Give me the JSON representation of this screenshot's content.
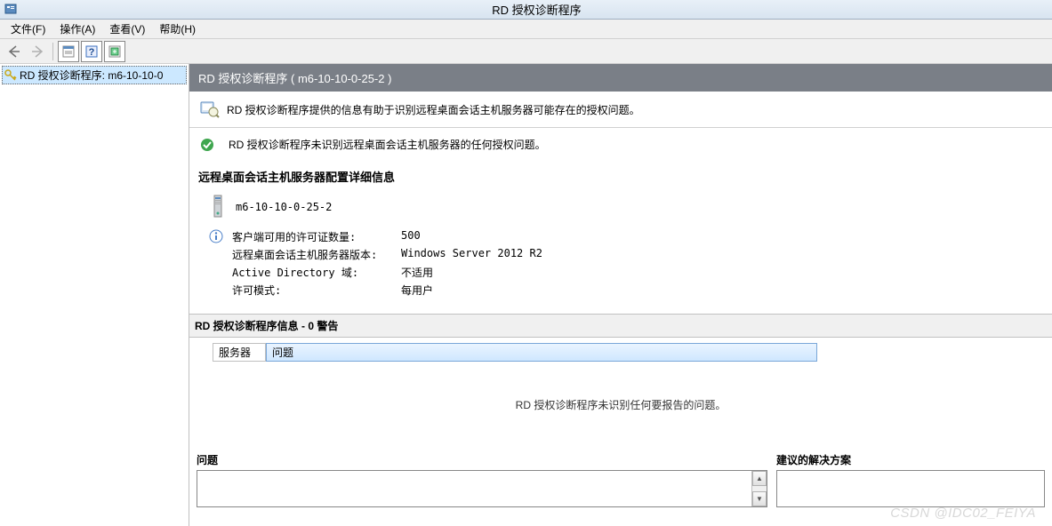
{
  "window": {
    "title": "RD 授权诊断程序"
  },
  "menu": {
    "file": "文件(F)",
    "action": "操作(A)",
    "view": "查看(V)",
    "help": "帮助(H)"
  },
  "tree": {
    "root": "RD 授权诊断程序: m6-10-10-0"
  },
  "header": {
    "title": "RD 授权诊断程序 ( m6-10-10-0-25-2 )"
  },
  "strip": {
    "text": "RD 授权诊断程序提供的信息有助于识别远程桌面会话主机服务器可能存在的授权问题。"
  },
  "ok": {
    "text": "RD 授权诊断程序未识别远程桌面会话主机服务器的任何授权问题。"
  },
  "section": {
    "title": "远程桌面会话主机服务器配置详细信息"
  },
  "server": {
    "name": "m6-10-10-0-25-2"
  },
  "details": {
    "count_label": "客户端可用的许可证数量:",
    "count_value": "500",
    "version_label": "远程桌面会话主机服务器版本:",
    "version_value": "Windows Server 2012 R2",
    "ad_label": "Active Directory 域:",
    "ad_value": "不适用",
    "mode_label": "许可模式:",
    "mode_value": "每用户"
  },
  "warnings": {
    "header": "RD 授权诊断程序信息 - 0 警告",
    "col_server": "服务器",
    "col_issue": "问题",
    "empty": "RD 授权诊断程序未识别任何要报告的问题。"
  },
  "panels": {
    "issue": "问题",
    "solution": "建议的解决方案"
  },
  "watermark": "CSDN @IDC02_FEIYA"
}
